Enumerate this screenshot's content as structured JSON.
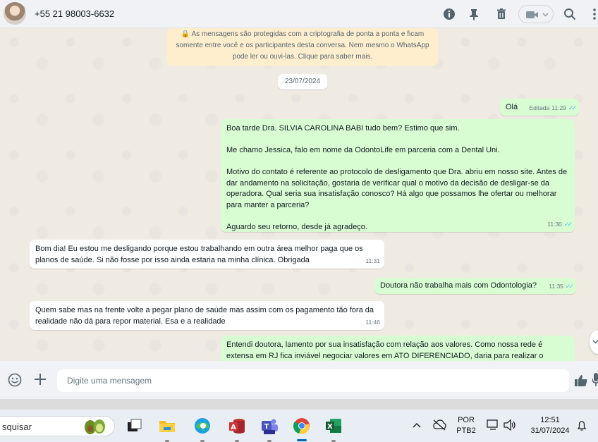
{
  "header": {
    "contact": "+55 21 98003-6632",
    "icons": [
      "info-icon",
      "pin-icon",
      "trash-icon",
      "video-call-icon",
      "chevron-down-icon",
      "search-icon",
      "more-icon"
    ]
  },
  "chat": {
    "notice_line1": "🔒 As mensagens são protegidas com a criptografia de ponta a ponta e ficam",
    "notice_line2": "somente entre você e os participantes desta conversa. Nem mesmo o WhatsApp",
    "notice_line3": "pode ler ou ouvi-las. Clique para saber mais.",
    "date": "23/07/2024",
    "messages": [
      {
        "dir": "out",
        "text": "Olá",
        "edited": "Editada",
        "time": "11:29"
      },
      {
        "dir": "out",
        "text": "Boa tarde Dra. SILVIA CAROLINA BABI tudo bem? Estimo que sim.\n\nMe chamo Jessica, falo em nome da OdontoLife em parceria com a Dental Uni.\n\nMotivo do contato é referente ao protocolo de desligamento que Dra. abriu em nosso site. Antes de dar andamento na solicitação, gostaria de verificar qual o motivo da decisão de desligar-se da operadora. Qual seria sua insatisfação conosco? Há algo que possamos lhe ofertar ou melhorar para manter a parceria?\n\nAguardo seu retorno, desde já agradeço.",
        "time": "11:30"
      },
      {
        "dir": "in",
        "text": "Bom dia! Eu estou me desligando porque estou trabalhando em outra área melhor paga que os planos de saúde. Si não fosse por isso ainda estaria na minha clínica. Obrigada",
        "time": "11:31"
      },
      {
        "dir": "out",
        "text": "Doutora não trabalha mais com Odontologia?",
        "time": "11:35"
      },
      {
        "dir": "in",
        "text": "Quem sabe mas na frente volte a pegar plano de saúde mas assim com os pagamento tão fora da realidade não dá para repor material. Esa e a realidade",
        "time": "11:46"
      },
      {
        "dir": "out",
        "text": "Entendi doutora, lamento por sua insatisfação com relação aos valores. Como nossa rede é extensa em RJ fica inviável negociar valores em ATO DIFERENCIADO, daria para realizar o reajuste",
        "time": ""
      }
    ]
  },
  "compose": {
    "placeholder": "Digite uma mensagem",
    "icons": [
      "emoji-icon",
      "plus-icon",
      "thumbs-up-icon",
      "mic-icon"
    ]
  },
  "taskbar": {
    "search_text": "squisar",
    "apps": [
      "avocado-widget-icon",
      "file-explorer-icon",
      "folder-icon",
      "edge-icon",
      "access-icon",
      "teams-icon",
      "chrome-icon",
      "excel-icon"
    ],
    "tray": {
      "lang_line1": "POR",
      "lang_line2": "PTB2",
      "time": "12:51",
      "date": "31/07/2024"
    }
  },
  "colors": {
    "outgoing_bubble": "#d9fdd3",
    "incoming_bubble": "#ffffff",
    "chat_bg": "#efeae2",
    "ticks": "#53bdeb"
  }
}
